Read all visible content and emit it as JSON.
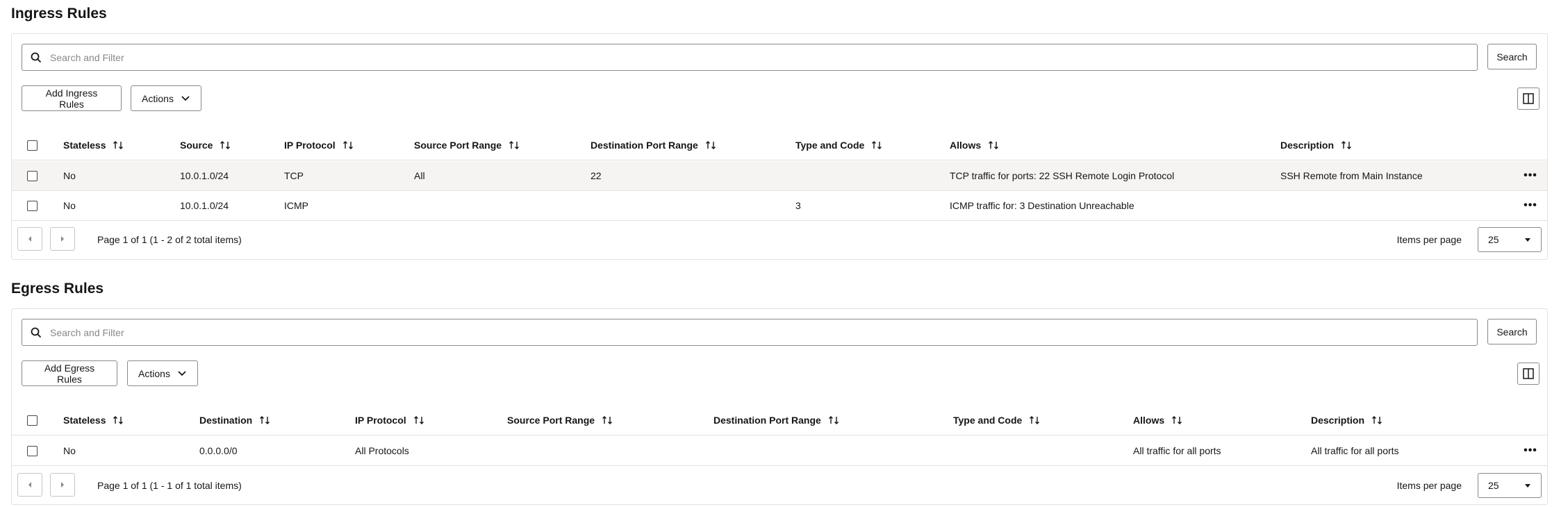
{
  "ingress": {
    "title": "Ingress Rules",
    "search_placeholder": "Search and Filter",
    "search_button": "Search",
    "add_button": "Add Ingress Rules",
    "actions_button": "Actions",
    "columns": [
      "Stateless",
      "Source",
      "IP Protocol",
      "Source Port Range",
      "Destination Port Range",
      "Type and Code",
      "Allows",
      "Description"
    ],
    "rows": [
      [
        "No",
        "10.0.1.0/24",
        "TCP",
        "All",
        "22",
        "",
        "TCP traffic for ports: 22 SSH Remote Login Protocol",
        "SSH Remote from Main Instance"
      ],
      [
        "No",
        "10.0.1.0/24",
        "ICMP",
        "",
        "",
        "3",
        "ICMP traffic for: 3 Destination Unreachable",
        ""
      ]
    ],
    "page_info": "Page 1 of 1 (1 - 2 of 2 total items)",
    "items_per_page_label": "Items per page",
    "items_per_page": "25"
  },
  "egress": {
    "title": "Egress Rules",
    "search_placeholder": "Search and Filter",
    "search_button": "Search",
    "add_button": "Add Egress Rules",
    "actions_button": "Actions",
    "columns": [
      "Stateless",
      "Destination",
      "IP Protocol",
      "Source Port Range",
      "Destination Port Range",
      "Type and Code",
      "Allows",
      "Description"
    ],
    "rows": [
      [
        "No",
        "0.0.0.0/0",
        "All Protocols",
        "",
        "",
        "",
        "All traffic for all ports",
        "All traffic for all ports"
      ]
    ],
    "page_info": "Page 1 of 1 (1 - 1 of 1 total items)",
    "items_per_page_label": "Items per page",
    "items_per_page": "25"
  },
  "icons": {
    "search": "search-icon",
    "sort": "sort-icon",
    "chevron": "chevron-down-icon",
    "kebab": "more-actions-icon",
    "columns": "columns-icon",
    "prev": "previous-page-icon",
    "next": "next-page-icon"
  }
}
